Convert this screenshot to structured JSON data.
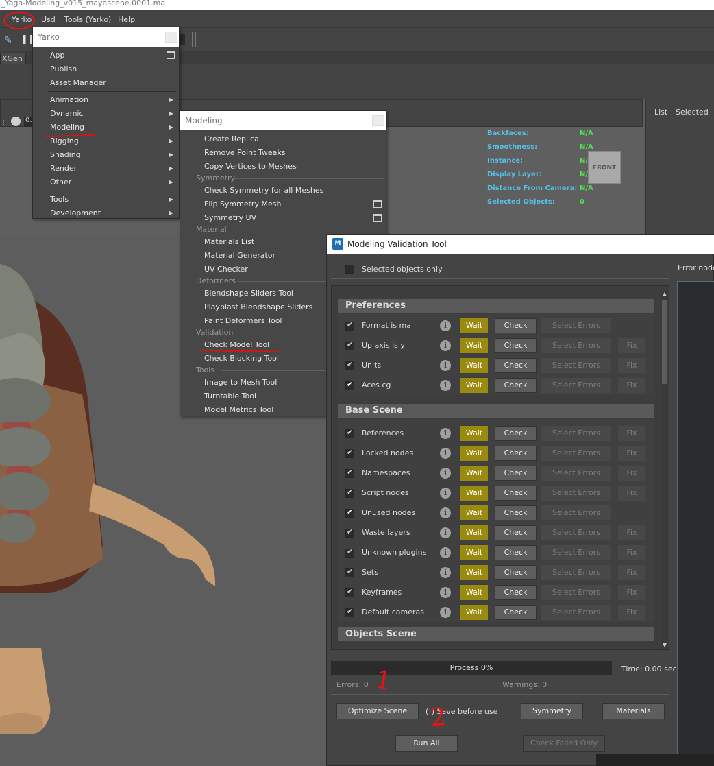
{
  "window": {
    "title": "_Yaga-Modeling_v015_mayascene.0001.ma"
  },
  "menubar": {
    "items": [
      "Yarko",
      "Usd",
      "Tools (Yarko)",
      "Help"
    ]
  },
  "shelf": {
    "tab": "XGen"
  },
  "outliner": {
    "list": "List",
    "selected": "Selected"
  },
  "hud": {
    "rows": [
      {
        "label": "Backfaces:",
        "value": "N/A"
      },
      {
        "label": "Smoothness:",
        "value": "N/A"
      },
      {
        "label": "Instance:",
        "value": "N/A"
      },
      {
        "label": "Display Layer:",
        "value": "N/A"
      },
      {
        "label": "Distance From Camera:",
        "value": "N/A"
      },
      {
        "label": "Selected Objects:",
        "value": "0"
      }
    ],
    "view_cube": "FRONT",
    "field_value": "0."
  },
  "yarko_menu": {
    "title": "Yarko",
    "items": [
      "App",
      "Publish",
      "Asset Manager",
      "Animation",
      "Dynamic",
      "Modeling",
      "Rigging",
      "Shading",
      "Render",
      "Other",
      "Tools",
      "Development"
    ]
  },
  "modeling_menu": {
    "title": "Modeling",
    "items": [
      "Create Replica",
      "Remove Point Tweaks",
      "Copy Vertices to Meshes"
    ],
    "sections": [
      {
        "name": "Symmetry",
        "items": [
          "Check Symmetry for all Meshes",
          "Flip Symmetry Mesh",
          "Symmetry UV"
        ]
      },
      {
        "name": "Material",
        "items": [
          "Materials List",
          "Material Generator",
          "UV Checker"
        ]
      },
      {
        "name": "Deformers",
        "items": [
          "Blendshape Sliders Tool",
          "Playblast Blendshape Sliders",
          "Paint Deformers Tool"
        ]
      },
      {
        "name": "Validation",
        "items": [
          "Check Model Tool",
          "Check Blocking Tool"
        ]
      },
      {
        "name": "Tools",
        "items": [
          "Image to Mesh Tool",
          "Turntable Tool",
          "Model Metrics Tool"
        ]
      }
    ]
  },
  "validation_tool": {
    "title": "Modeling Validation Tool",
    "selected_only": "Selected objects only",
    "error_nodes": "Error node",
    "wait_label": "Wait",
    "check_label": "Check",
    "select_errors_label": "Select Errors",
    "fix_label": "Fix",
    "sections": [
      {
        "name": "Preferences",
        "rows": [
          {
            "label": "Format is ma",
            "fix": false,
            "checked_bright": false
          },
          {
            "label": "Up axis is y",
            "fix": true,
            "checked_bright": false
          },
          {
            "label": "Units",
            "fix": true,
            "checked_bright": false
          },
          {
            "label": "Aces cg",
            "fix": true,
            "checked_bright": true
          }
        ]
      },
      {
        "name": "Base Scene",
        "rows": [
          {
            "label": "References",
            "fix": true,
            "checked_bright": false
          },
          {
            "label": "Locked nodes",
            "fix": true,
            "checked_bright": false
          },
          {
            "label": "Namespaces",
            "fix": true,
            "checked_bright": false
          },
          {
            "label": "Script nodes",
            "fix": true,
            "checked_bright": false
          },
          {
            "label": "Unused nodes",
            "fix": false,
            "checked_bright": true
          },
          {
            "label": "Waste layers",
            "fix": true,
            "checked_bright": false
          },
          {
            "label": "Unknown plugins",
            "fix": true,
            "checked_bright": false
          },
          {
            "label": "Sets",
            "fix": true,
            "checked_bright": false
          },
          {
            "label": "Keyframes",
            "fix": true,
            "checked_bright": false
          },
          {
            "label": "Default cameras",
            "fix": true,
            "checked_bright": false
          }
        ]
      },
      {
        "name": "Objects Scene",
        "rows": []
      }
    ],
    "process": "Process 0%",
    "time": "Time: 0.00 sec",
    "errors": "Errors: 0",
    "warnings": "Warnings: 0",
    "optimize": "Optimize Scene",
    "save_note": "(!) Save before use",
    "symmetry": "Symmetry",
    "materials": "Materials",
    "run_all": "Run All",
    "check_failed": "Check Failed Only"
  },
  "annotations": {
    "step1": "1",
    "step2": "2"
  },
  "colors": {
    "wait": "#9a8a0f",
    "hud_label": "#56c1e8",
    "hud_value": "#4fe34f",
    "annotation": "#e11111"
  }
}
